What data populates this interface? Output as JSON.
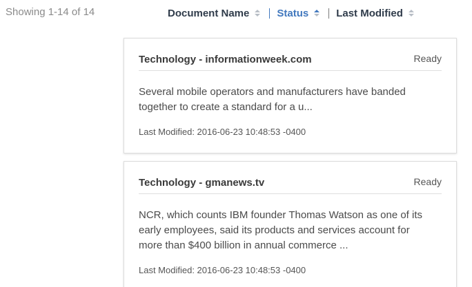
{
  "results": {
    "count_text": "Showing 1-14 of 14"
  },
  "sort": {
    "document_name": "Document Name",
    "status": "Status",
    "last_modified": "Last Modified"
  },
  "documents": [
    {
      "title": "Technology - informationweek.com",
      "status": "Ready",
      "snippet": "Several mobile operators and manufacturers have banded together to create a standard for a u...",
      "last_modified": "Last Modified: 2016-06-23 10:48:53 -0400"
    },
    {
      "title": "Technology - gmanews.tv",
      "status": "Ready",
      "snippet": "NCR, which counts IBM founder Thomas Watson as one of its early employees, said its products and services account for more than $400 billion in annual commerce ...",
      "last_modified": "Last Modified: 2016-06-23 10:48:53 -0400"
    }
  ]
}
